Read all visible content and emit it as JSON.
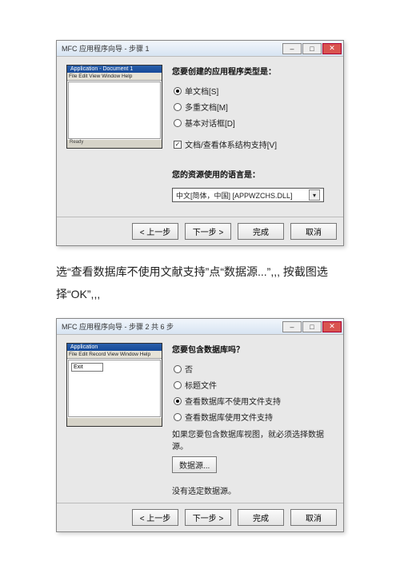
{
  "dialog1": {
    "title": "MFC 应用程序向导 - 步骤 1",
    "preview": {
      "title": "Application - Document 1",
      "menu": "File Edit View Window Help",
      "status": "Ready"
    },
    "prompt": "您要创建的应用程序类型是：",
    "opts": {
      "sdi": "单文档[S]",
      "mdi": "多重文档[M]",
      "dlg": "基本对话框[D]",
      "docview": "文档/查看体系结构支持[V]"
    },
    "langPrompt": "您的资源使用的语言是：",
    "langValue": "中文[简体，中国] [APPWZCHS.DLL]"
  },
  "interText": "选“查看数据库不使用文献支持”点“数据源...”,,, 按截图选择“OK”,,,",
  "dialog2": {
    "title": "MFC 应用程序向导 - 步骤 2 共 6 步",
    "preview": {
      "title": "Application",
      "menu": "File Edit Record View Window Help",
      "cell": "Exit"
    },
    "prompt": "您要包含数据库吗？",
    "opts": {
      "no": "否",
      "hdr": "标题文件",
      "nofile": "查看数据库不使用文件支持",
      "file": "查看数据库使用文件支持"
    },
    "note1": "如果您要包含数据库视图，就必须选择数据源。",
    "dsBtn": "数据源...",
    "note2": "没有选定数据源。"
  },
  "buttons": {
    "back": "< 上一步",
    "next": "下一步 >",
    "finish": "完成",
    "cancel": "取消"
  }
}
